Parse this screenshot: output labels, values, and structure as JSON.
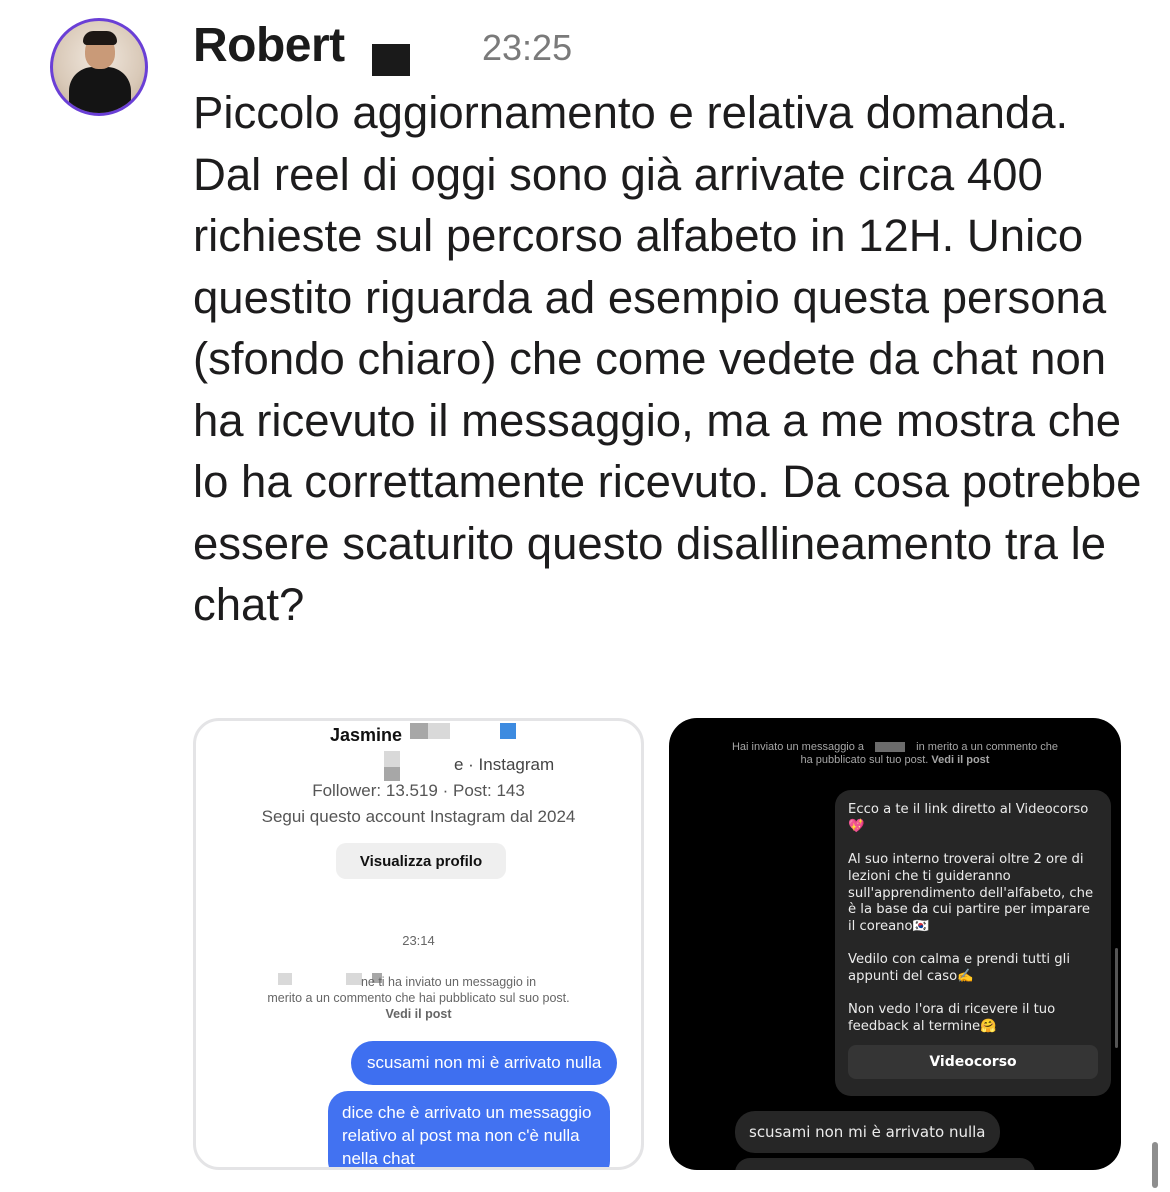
{
  "post": {
    "author": "Robert",
    "time": "23:25",
    "message": "Piccolo aggiornamento e relativa domanda. Dal reel di oggi sono già arrivate circa 400 richieste sul percorso alfabeto in 12H. Unico questito riguarda ad esempio questa persona (sfondo chiaro) che come vedete da chat non ha ricevuto il messaggio, ma a me mostra che lo ha correttamente ricevuto. Da cosa potrebbe essere scaturito questo disallineamento tra le chat?"
  },
  "left_screenshot": {
    "profile_name": "Jasmine",
    "profile_sub": "e · Instagram",
    "stats": "Follower: 13.519 · Post: 143",
    "since": "Segui questo account Instagram dal 2024",
    "view_profile_label": "Visualizza profilo",
    "timestamp": "23:14",
    "notice_line1": "ne ti ha inviato un messaggio in",
    "notice_line2": "merito a un commento che hai pubblicato sul suo post.",
    "notice_link": "Vedi il post",
    "bubble_1": "scusami non mi è arrivato nulla",
    "bubble_2": "dice che è arrivato un messaggio relativo al post ma non c'è nulla nella chat"
  },
  "right_screenshot": {
    "notice_line1": "Hai inviato un messaggio a",
    "notice_line1b": "in merito a un commento che",
    "notice_line2": "ha pubblicato sul tuo post.",
    "notice_link": "Vedi il post",
    "card_p1": "Ecco a te il link diretto al Videocorso 💖",
    "card_p2": "Al suo interno troverai oltre 2 ore di lezioni che ti guideranno sull'apprendimento dell'alfabeto, che è la base da cui partire per imparare il coreano🇰🇷",
    "card_p3": "Vedilo con calma e prendi tutti gli appunti del caso✍️",
    "card_p4": "Non vedo l'ora di ricevere il tuo feedback al termine🤗",
    "card_button": "Videocorso",
    "bubble_1": "scusami non mi è arrivato nulla"
  },
  "colors": {
    "avatar_ring": "#6a3fd6",
    "sent_bubble": "#3e6ff0",
    "dark_card": "#262626"
  }
}
